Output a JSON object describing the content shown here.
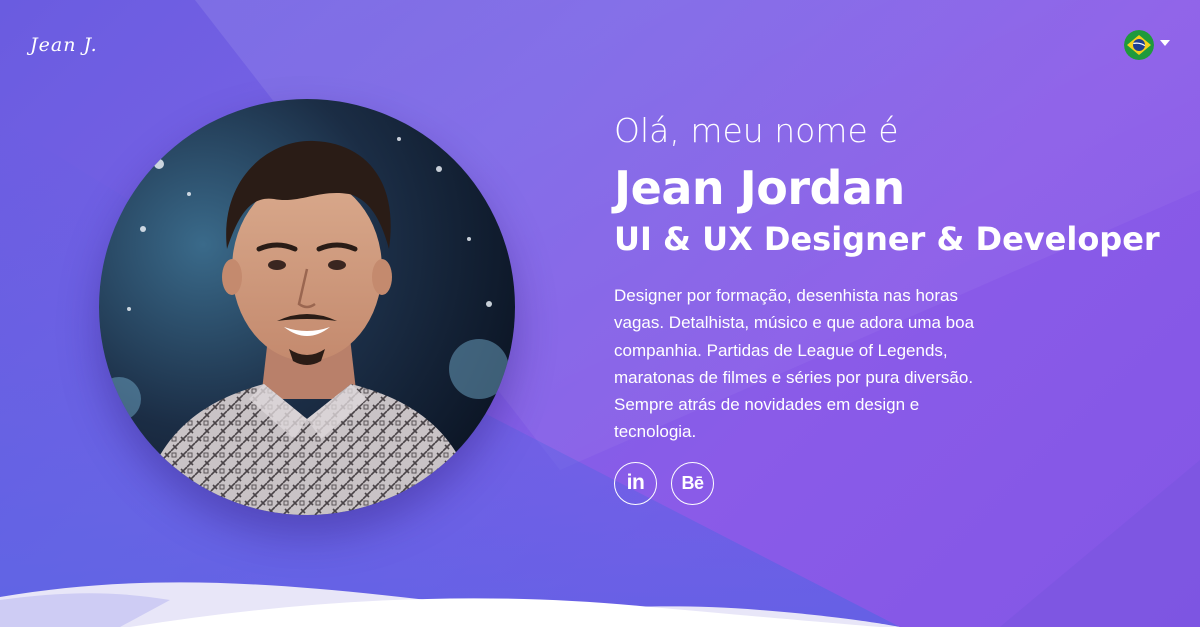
{
  "header": {
    "brand": "Jean J.",
    "language": {
      "flag_icon": "brazil-flag-icon",
      "caret_icon": "caret-down-icon"
    }
  },
  "hero": {
    "greeting": "Olá, meu nome é",
    "name": "Jean Jordan",
    "role": "UI & UX Designer & Developer",
    "bio": "Designer por formação, desenhista nas horas vagas. Detalhista, músico e que adora uma boa companhia. Partidas de League of Legends, maratonas de filmes e séries por pura diversão. Sempre atrás de novidades em design e tecnologia.",
    "socials": [
      {
        "label": "in",
        "icon": "linkedin-icon"
      },
      {
        "label": "Bē",
        "icon": "behance-icon"
      }
    ]
  },
  "colors": {
    "gradient_start": "#6a5ce0",
    "gradient_end": "#8356e6",
    "text": "#ffffff"
  }
}
